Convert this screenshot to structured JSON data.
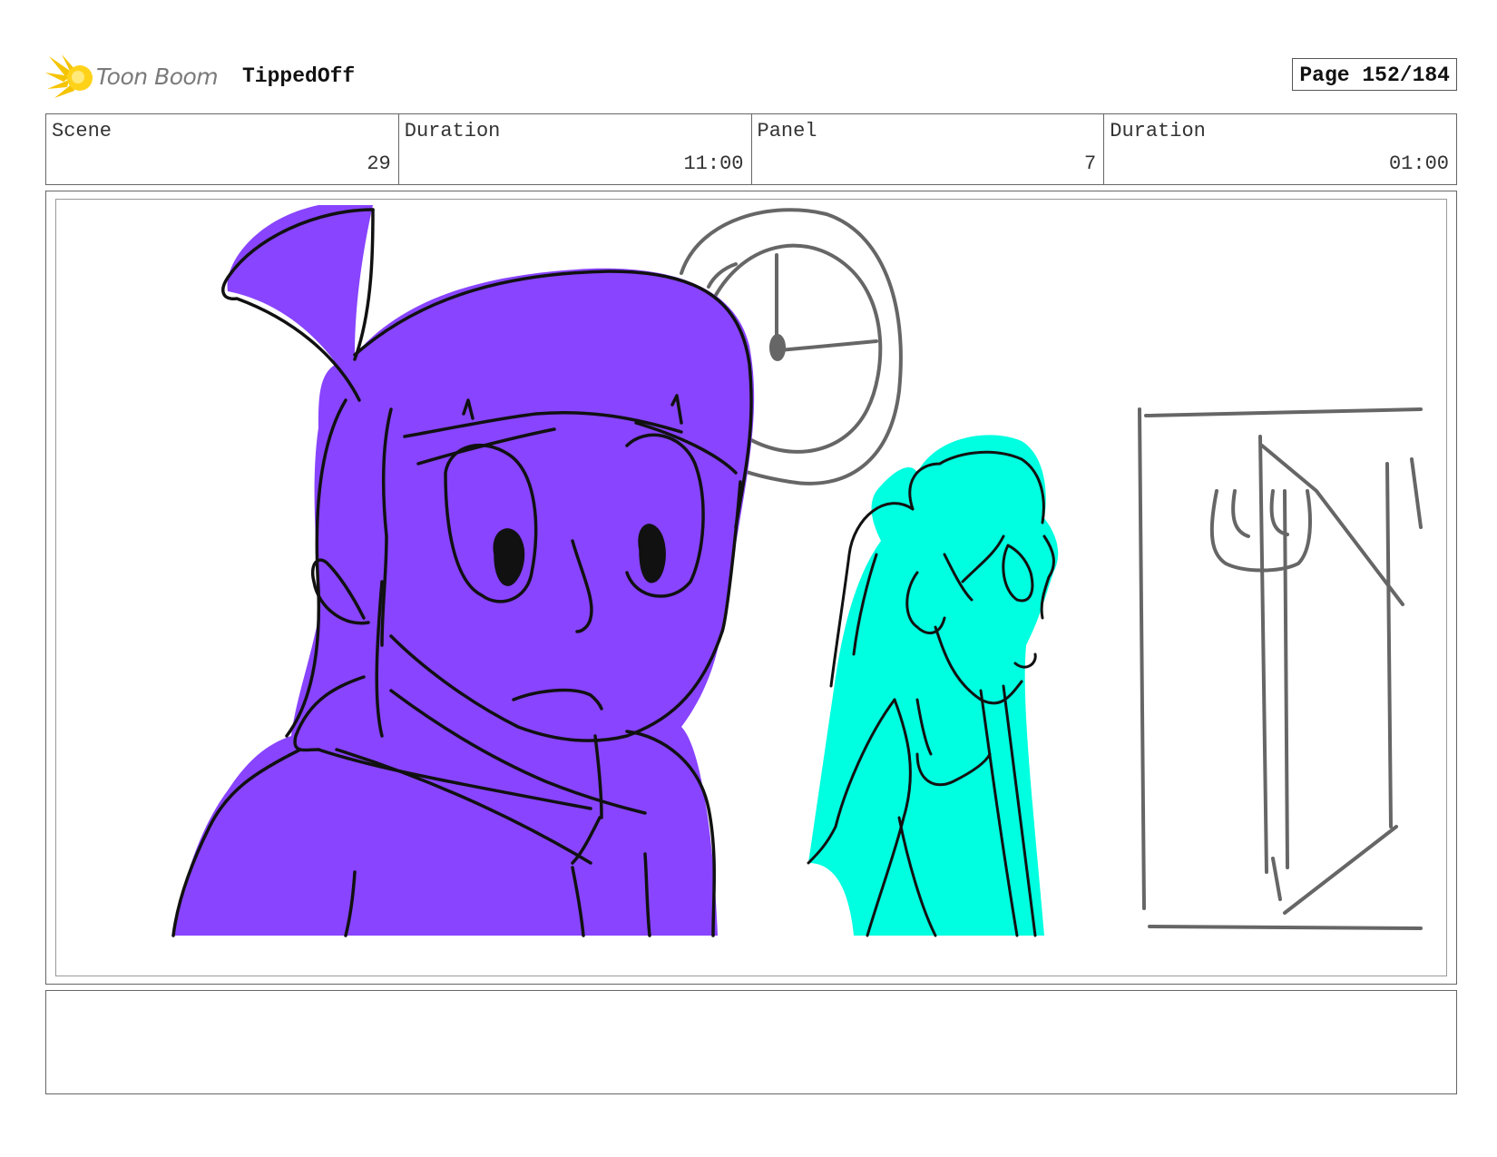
{
  "header": {
    "logo_text": "Toon Boom",
    "project_title": "TippedOff",
    "page_label": "Page 152/184"
  },
  "info": [
    {
      "label": "Scene",
      "value": "29"
    },
    {
      "label": "Duration",
      "value": "11:00"
    },
    {
      "label": "Panel",
      "value": "7"
    },
    {
      "label": "Duration",
      "value": "01:00"
    }
  ],
  "colors": {
    "purple_character": "#8844ff",
    "cyan_character": "#00ffe0",
    "sketch_gray": "#666666",
    "logo_yellow": "#f5c400"
  },
  "caption": {
    "text": ""
  }
}
